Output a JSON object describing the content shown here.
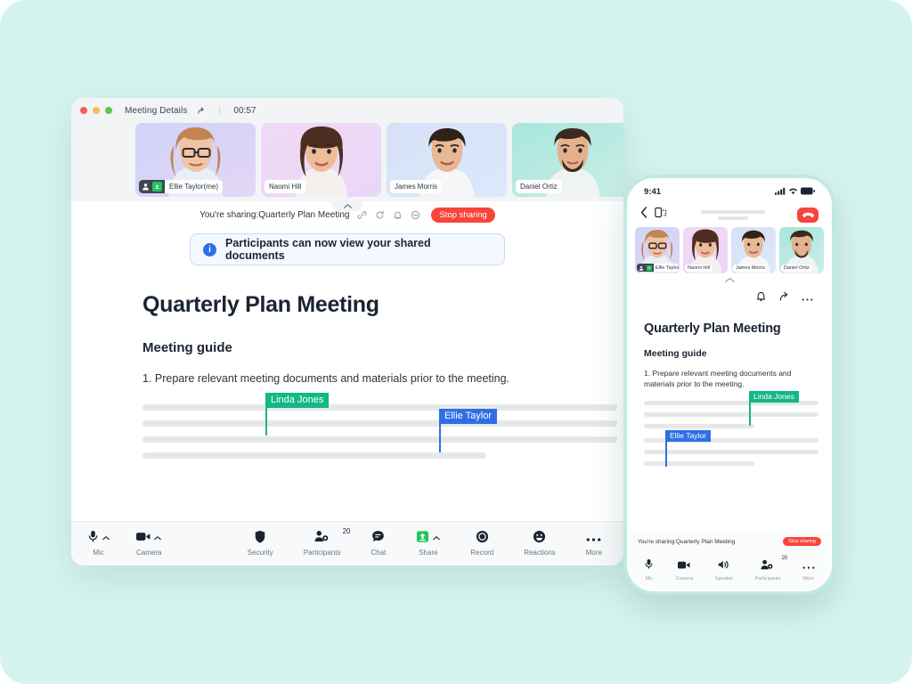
{
  "theme": {
    "background": "#d5f4ef",
    "accent_green": "#12b886",
    "accent_blue": "#2f6fe4",
    "danger_red": "#f8453c",
    "share_green": "#22c55e"
  },
  "desktop": {
    "titlebar": {
      "title": "Meeting Details",
      "share_icon": "share-icon",
      "timer": "00:57",
      "traffic_lights": [
        "close",
        "minimize",
        "maximize"
      ]
    },
    "participants": [
      {
        "name": "Ellie Taylor(me)",
        "is_host": true,
        "sharing": true,
        "gradient": "g1"
      },
      {
        "name": "Naomi Hill",
        "is_host": false,
        "sharing": false,
        "gradient": "g2"
      },
      {
        "name": "James Morris",
        "is_host": false,
        "sharing": false,
        "gradient": "g3"
      },
      {
        "name": "Daniel Ortiz",
        "is_host": false,
        "sharing": false,
        "gradient": "g4"
      }
    ],
    "share_bar": {
      "text": "You're sharing:Quarterly Plan Meeting",
      "icons": [
        "link-icon",
        "refresh-icon",
        "bell-icon",
        "minus-circle-icon"
      ],
      "stop_label": "Stop sharing"
    },
    "banner": {
      "badge": "i",
      "text": "Participants can now view your shared documents"
    },
    "document": {
      "title": "Quarterly Plan Meeting",
      "subtitle": "Meeting guide",
      "paragraph": "1. Prepare relevant meeting documents and materials prior to the meeting.",
      "cursors": [
        {
          "label": "Linda Jones",
          "color": "#12b886"
        },
        {
          "label": "Ellie Taylor",
          "color": "#2f6fe4"
        }
      ]
    },
    "toolbar": {
      "left": [
        {
          "label": "Mic",
          "icon": "microphone-icon",
          "caret": true
        },
        {
          "label": "Camera",
          "icon": "camera-icon",
          "caret": true
        }
      ],
      "right": [
        {
          "label": "Security",
          "icon": "shield-icon",
          "caret": false,
          "count": ""
        },
        {
          "label": "Participants",
          "icon": "participants-icon",
          "caret": false,
          "count": "20"
        },
        {
          "label": "Chat",
          "icon": "chat-icon",
          "caret": false,
          "count": ""
        },
        {
          "label": "Share",
          "icon": "share-screen-icon",
          "caret": true,
          "count": ""
        },
        {
          "label": "Record",
          "icon": "record-icon",
          "caret": false,
          "count": ""
        },
        {
          "label": "Reactions",
          "icon": "reactions-icon",
          "caret": false,
          "count": ""
        },
        {
          "label": "More",
          "icon": "more-icon",
          "caret": false,
          "count": ""
        }
      ]
    }
  },
  "phone": {
    "status": {
      "clock": "9:41",
      "icons": [
        "cellular-icon",
        "wifi-icon",
        "battery-icon"
      ]
    },
    "nav": {
      "back_icon": "chevron-left-icon",
      "flip_icon": "switch-device-icon",
      "end_call_icon": "end-call-icon"
    },
    "participants": [
      {
        "name": "Ellie Taylor(...",
        "is_host": true,
        "sharing": true,
        "gradient": "g1"
      },
      {
        "name": "Naomi Hill",
        "is_host": false,
        "sharing": false,
        "gradient": "g2"
      },
      {
        "name": "James Morris",
        "is_host": false,
        "sharing": false,
        "gradient": "g3"
      },
      {
        "name": "Daniel Ortiz",
        "is_host": false,
        "sharing": false,
        "gradient": "g4"
      }
    ],
    "actions": [
      "bell-icon",
      "share-icon",
      "more-icon"
    ],
    "document": {
      "title": "Quarterly Plan Meeting",
      "subtitle": "Meeting guide",
      "paragraph": "1. Prepare relevant meeting documents and materials prior to the meeting.",
      "cursors": [
        {
          "label": "Linda Jones",
          "color": "#12b886"
        },
        {
          "label": "Ellie Taylor",
          "color": "#2f6fe4"
        }
      ]
    },
    "share_bar": {
      "text": "You're sharing:Quarterly Plan Meeting",
      "stop_label": "Stop sharing"
    },
    "toolbar": [
      {
        "label": "Mic",
        "icon": "microphone-icon",
        "count": ""
      },
      {
        "label": "Camera",
        "icon": "camera-icon",
        "count": ""
      },
      {
        "label": "Speaker",
        "icon": "speaker-icon",
        "count": ""
      },
      {
        "label": "Participants",
        "icon": "participants-icon",
        "count": "20"
      },
      {
        "label": "More",
        "icon": "more-icon",
        "count": ""
      }
    ]
  }
}
